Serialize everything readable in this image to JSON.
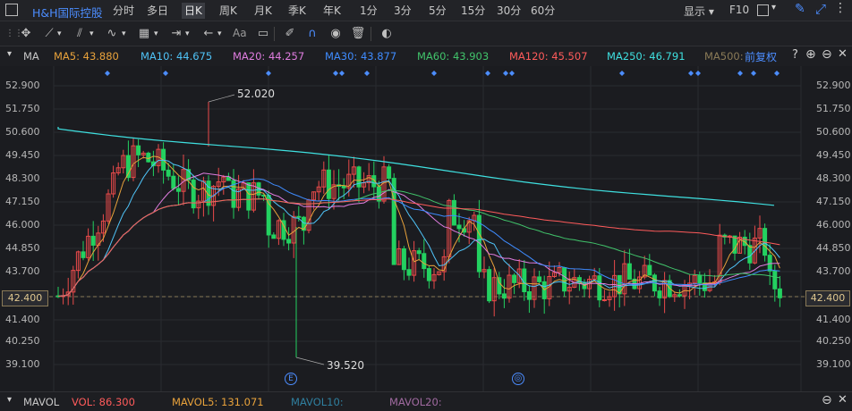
{
  "app": {
    "stock_name": "H&H国际控股",
    "period_tabs": [
      "分时",
      "多日",
      "日K",
      "周K",
      "月K",
      "季K",
      "年K",
      "1分",
      "3分",
      "5分",
      "15分",
      "30分",
      "60分"
    ],
    "active_tab": "日K",
    "display_label": "显示",
    "f10_label": "F10"
  },
  "toolbar": {
    "text_tool_label": "Aa"
  },
  "ma_bar": {
    "title": "MA",
    "items": [
      {
        "label": "MA5: 43.880",
        "color": "#e8a23b"
      },
      {
        "label": "MA10: 44.675",
        "color": "#4fc3f7"
      },
      {
        "label": "MA20: 44.257",
        "color": "#e07de0"
      },
      {
        "label": "MA30: 43.877",
        "color": "#3f8cff"
      },
      {
        "label": "MA60: 43.903",
        "color": "#41c46b"
      },
      {
        "label": "MA120: 45.507",
        "color": "#ff5b5b"
      },
      {
        "label": "MA250: 46.791",
        "color": "#3fe0e0"
      },
      {
        "label": "MA500:",
        "color": "#8a7a57"
      }
    ],
    "adjust_label": "前复权"
  },
  "chart": {
    "y_ticks": [
      "52.900",
      "51.750",
      "50.600",
      "49.450",
      "48.300",
      "47.150",
      "46.000",
      "44.850",
      "43.700",
      "42.400",
      "41.400",
      "40.250",
      "39.100"
    ],
    "current_price": "42.400",
    "high_label": "52.020",
    "low_label": "39.520",
    "event_markers": [
      "E",
      "◎"
    ],
    "colors": {
      "up": "#e94a4a",
      "down": "#23d160",
      "bg": "#1b1c20",
      "grid": "#2a2b30"
    }
  },
  "vol_bar": {
    "title": "MAVOL",
    "items": [
      {
        "label": "VOL: 86.300",
        "color": "#ff5b5b"
      },
      {
        "label": "MAVOL5: 131.071",
        "color": "#e8a23b"
      },
      {
        "label": "MAVOL10:",
        "color": "#2f7f9f"
      },
      {
        "label": "MAVOL20:",
        "color": "#a06aa0"
      }
    ]
  }
}
